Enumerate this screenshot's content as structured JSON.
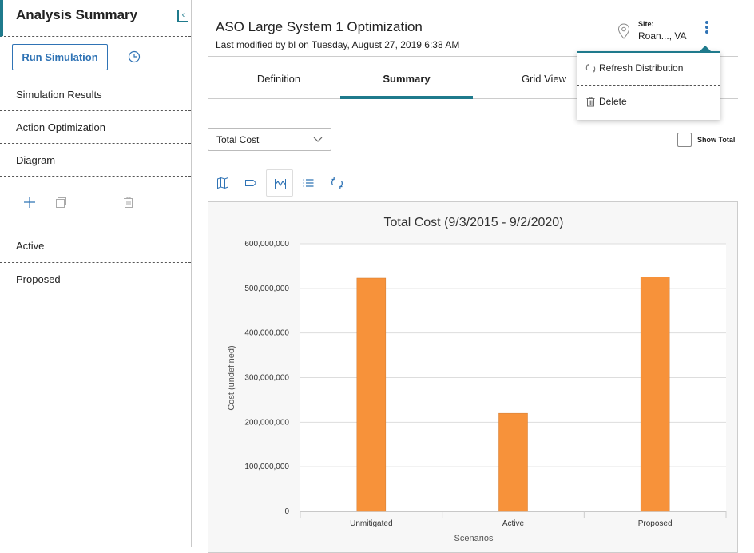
{
  "sidebar": {
    "title": "Analysis Summary",
    "run_label": "Run Simulation",
    "items": [
      {
        "label": "Simulation Results"
      },
      {
        "label": "Action Optimization"
      },
      {
        "label": "Diagram"
      }
    ],
    "scenarios": [
      {
        "label": "Active"
      },
      {
        "label": "Proposed"
      }
    ]
  },
  "header": {
    "title": "ASO Large System 1 Optimization",
    "subtitle": "Last modified by bl on Tuesday, August 27, 2019 6:38 AM",
    "site_label": "Site:",
    "site_value": "Roan..., VA"
  },
  "tabs": [
    {
      "label": "Definition"
    },
    {
      "label": "Summary"
    },
    {
      "label": "Grid View"
    }
  ],
  "menu": {
    "refresh_label": "Refresh Distribution",
    "delete_label": "Delete"
  },
  "controls": {
    "metric_value": "Total Cost",
    "show_total_label": "Show Total"
  },
  "colors": {
    "accent": "#1f7a8c",
    "link": "#2f73b5",
    "bar": "#f7923a"
  },
  "chart_data": {
    "type": "bar",
    "title": "Total Cost (9/3/2015 - 9/2/2020)",
    "xlabel": "Scenarios",
    "ylabel": "Cost (undefined)",
    "categories": [
      "Unmitigated",
      "Active",
      "Proposed"
    ],
    "values": [
      523000000,
      220000000,
      526000000
    ],
    "ylim": [
      0,
      600000000
    ],
    "yticks": [
      0,
      100000000,
      200000000,
      300000000,
      400000000,
      500000000,
      600000000
    ],
    "ytick_labels": [
      "0",
      "100,000,000",
      "200,000,000",
      "300,000,000",
      "400,000,000",
      "500,000,000",
      "600,000,000"
    ],
    "grid": true,
    "legend": "none"
  }
}
